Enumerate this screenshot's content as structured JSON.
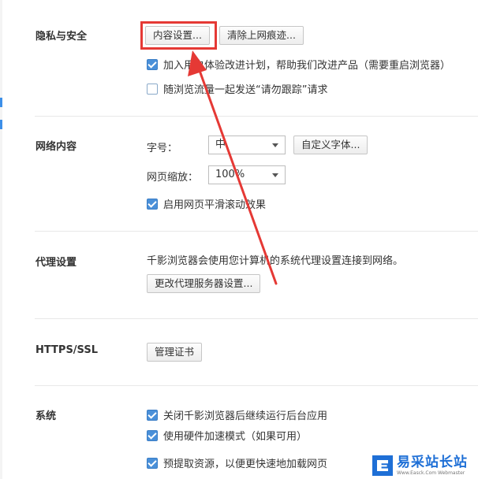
{
  "privacy": {
    "title": "隐私与安全",
    "content_settings_button": "内容设置...",
    "clear_traces_button": "清除上网痕迹...",
    "experience_program": "加入用户体验改进计划，帮助我们改进产品（需要重启浏览器）",
    "do_not_track": "随浏览流量一起发送“请勿跟踪”请求"
  },
  "web_content": {
    "title": "网络内容",
    "font_size_label": "字号：",
    "font_size_value": "中",
    "custom_fonts_button": "自定义字体...",
    "zoom_label": "网页缩放：",
    "zoom_value": "100%",
    "smooth_scroll": "启用网页平滑滚动效果"
  },
  "proxy": {
    "title": "代理设置",
    "description": "千影浏览器会使用您计算机的系统代理设置连接到网络。",
    "change_button": "更改代理服务器设置..."
  },
  "https": {
    "title": "HTTPS/SSL",
    "manage_certs_button": "管理证书"
  },
  "system": {
    "title": "系统",
    "background_apps": "关闭千影浏览器后继续运行后台应用",
    "hardware_accel": "使用硬件加速模式（如果可用）",
    "prefetch": "预提取资源，以便更快速地加载网页"
  },
  "checkbox_states": {
    "experience_program": true,
    "do_not_track": false,
    "smooth_scroll": true,
    "background_apps": true,
    "hardware_accel": true,
    "prefetch": true
  },
  "watermark": {
    "main": "易采站长站",
    "sub": "Www.Easck.Com Webmaster"
  },
  "colors": {
    "highlight": "#e53935",
    "accent": "#4a90d9"
  }
}
